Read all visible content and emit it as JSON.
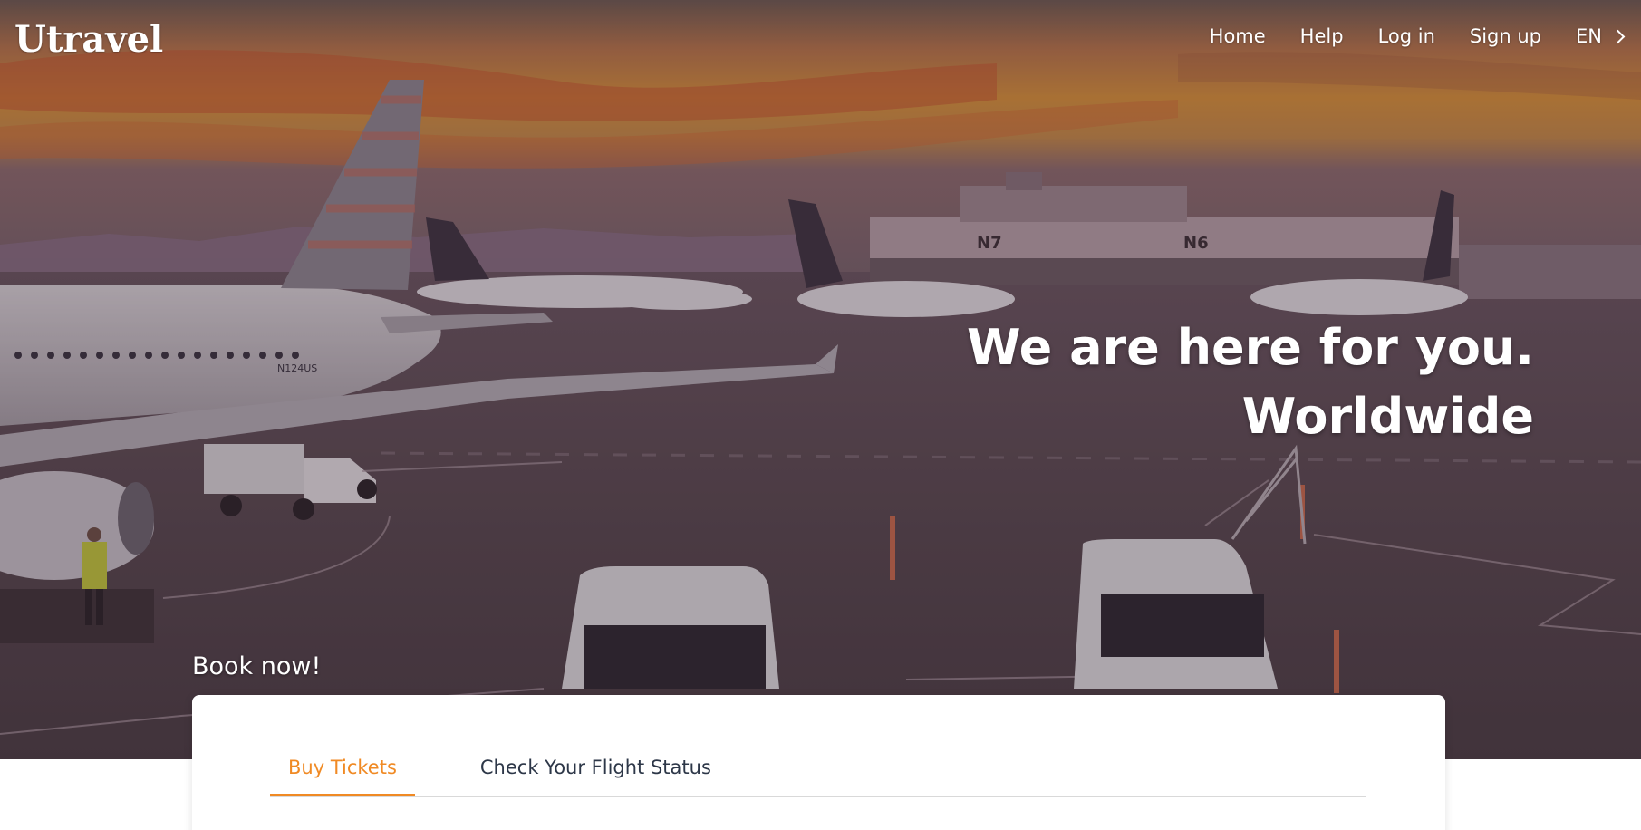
{
  "brand": {
    "logo": "Utravel"
  },
  "nav": {
    "items": [
      {
        "label": "Home"
      },
      {
        "label": "Help"
      },
      {
        "label": "Log in"
      },
      {
        "label": "Sign up"
      }
    ],
    "language": "EN"
  },
  "hero": {
    "line1": "We are here for you.",
    "line2": "Worldwide",
    "gate_signs": [
      "N7",
      "N6"
    ],
    "aircraft_registration": "N124US"
  },
  "booking": {
    "heading": "Book now!",
    "tabs": [
      {
        "label": "Buy Tickets",
        "active": true
      },
      {
        "label": "Check Your Flight Status",
        "active": false
      }
    ]
  },
  "colors": {
    "accent": "#f08a24",
    "tab_text": "#2d3748",
    "overlay": "#3b2a33"
  }
}
